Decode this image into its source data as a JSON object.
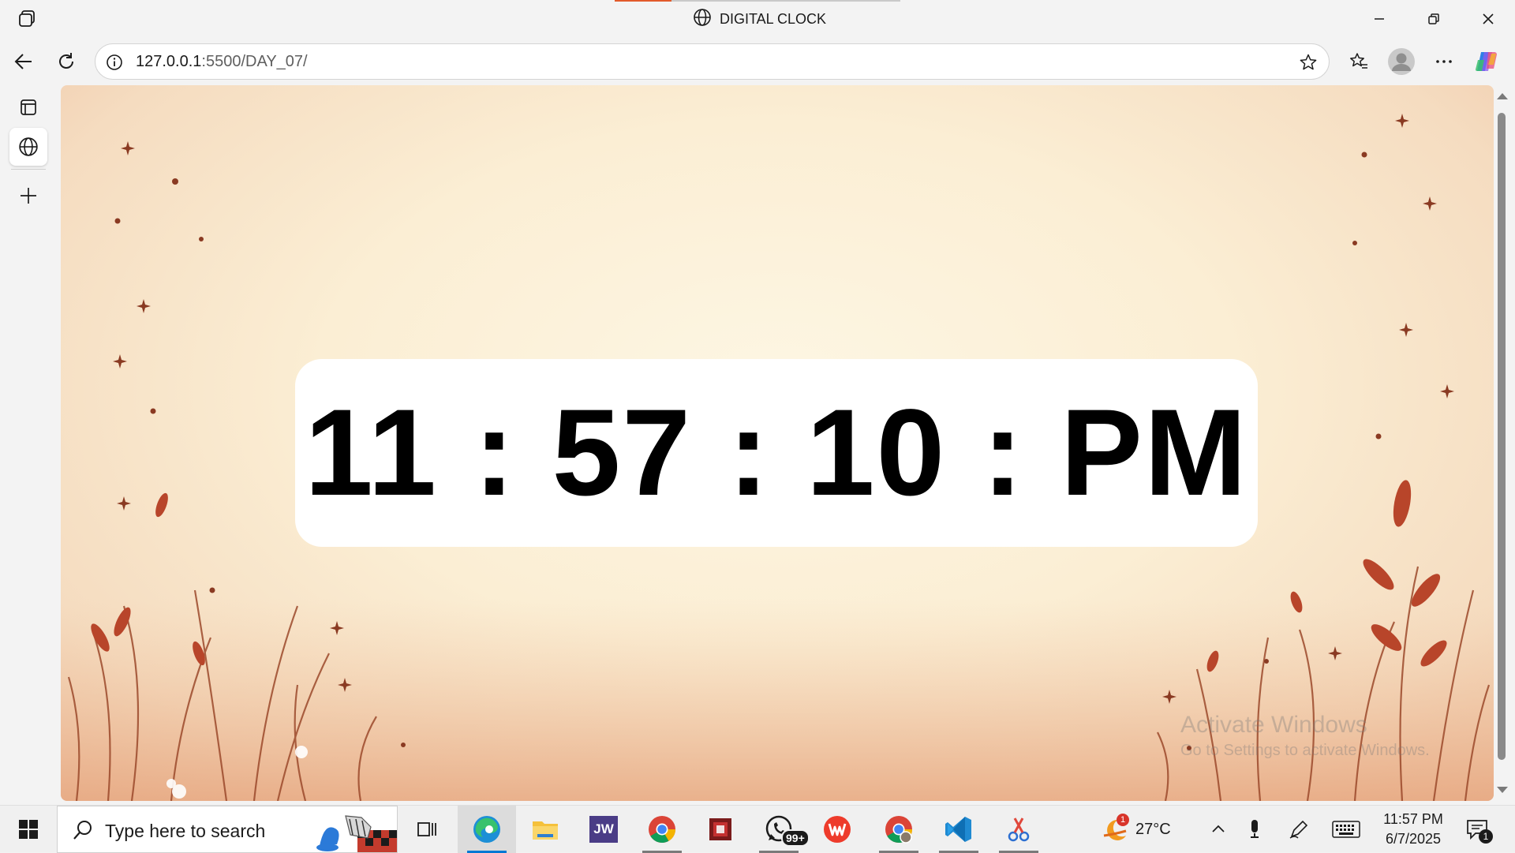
{
  "window": {
    "title": "DIGITAL CLOCK",
    "minimize_icon": "minimize-icon",
    "restore_icon": "restore-icon",
    "close_icon": "close-icon"
  },
  "toolbar": {
    "url_host": "127.0.0.1",
    "url_path": ":5500/DAY_07/",
    "back_icon": "arrow-left-icon",
    "refresh_icon": "refresh-icon",
    "info_icon": "info-icon",
    "favorite_icon": "star-icon",
    "favorites_icon": "favorites-icon",
    "profile_icon": "avatar-icon",
    "more_icon": "ellipsis-icon",
    "copilot_icon": "copilot-icon"
  },
  "sidebar": {
    "items": [
      {
        "name": "tab-actions",
        "icon": "tab-panel-icon"
      },
      {
        "name": "current-tab",
        "icon": "globe-icon"
      },
      {
        "name": "new-tab",
        "icon": "plus-icon"
      }
    ]
  },
  "page": {
    "clock_text": "11 : 57 : 10 : PM",
    "watermark_line1": "Activate Windows",
    "watermark_line2": "Go to Settings to activate Windows."
  },
  "taskbar": {
    "search_placeholder": "Type here to search",
    "apps": [
      {
        "name": "task-view",
        "icon": "task-view-icon"
      },
      {
        "name": "edge",
        "icon": "edge-icon",
        "active": true
      },
      {
        "name": "file-explorer",
        "icon": "folder-icon"
      },
      {
        "name": "jw-app",
        "label": "JW"
      },
      {
        "name": "chrome",
        "icon": "chrome-icon"
      },
      {
        "name": "app-red",
        "icon": "app-red-icon"
      },
      {
        "name": "whatsapp",
        "icon": "whatsapp-icon",
        "badge": "99+"
      },
      {
        "name": "wps",
        "icon": "wps-icon"
      },
      {
        "name": "chrome-profile",
        "icon": "chrome-icon"
      },
      {
        "name": "vscode",
        "icon": "vscode-icon"
      },
      {
        "name": "snipping-tool",
        "icon": "scissors-icon"
      }
    ],
    "weather": {
      "temp": "27°C",
      "badge": "1"
    },
    "time": "11:57 PM",
    "date": "6/7/2025",
    "notification_count": "1"
  },
  "colors": {
    "accent_tab": "#e25a2b",
    "page_bg": "#fbeed4",
    "leaf": "#b8452a",
    "card": "#ffffff"
  }
}
